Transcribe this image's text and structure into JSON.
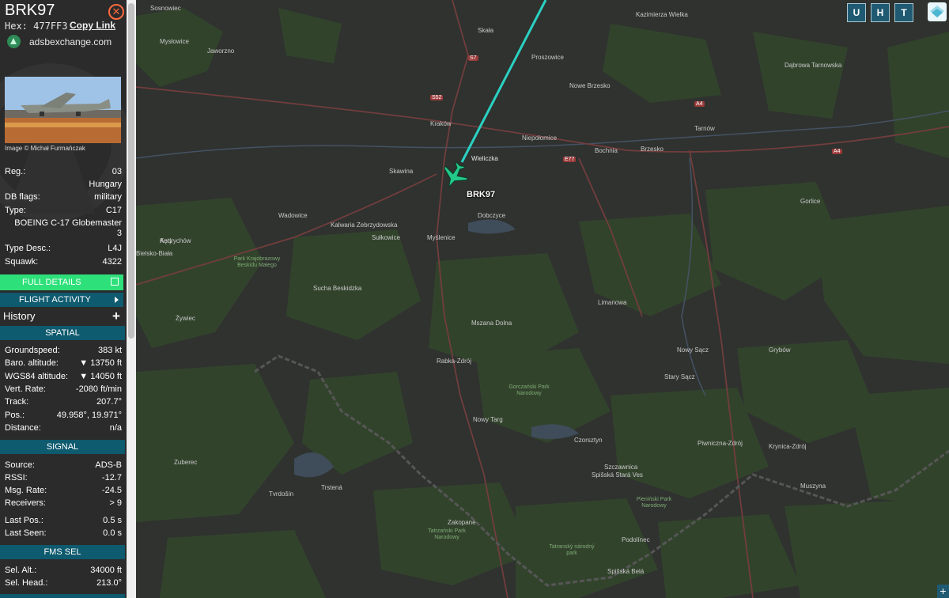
{
  "aircraft": {
    "callsign": "BRK97",
    "hex_label": "Hex:",
    "hex": "477FF3",
    "copy_link": "Copy Link",
    "source_site": "adsbexchange.com",
    "image_credit": "Image © Michał Furmańczak"
  },
  "details": [
    {
      "key": "Reg.:",
      "value": "03"
    },
    {
      "key": "",
      "value": "Hungary"
    },
    {
      "key": "DB flags:",
      "value": "military"
    },
    {
      "key": "Type:",
      "value": "C17"
    },
    {
      "key": "",
      "value": "BOEING C-17 Globemaster"
    },
    {
      "key": "",
      "value": "3"
    },
    {
      "key": "Type Desc.:",
      "value": "L4J"
    },
    {
      "key": "Squawk:",
      "value": "4322"
    }
  ],
  "buttons": {
    "full_details": "FULL DETAILS",
    "flight_activity": "FLIGHT ACTIVITY",
    "history": "History",
    "history_add": "+"
  },
  "spatial": {
    "title": "SPATIAL",
    "rows": [
      {
        "key": "Groundspeed:",
        "value": "383 kt"
      },
      {
        "key": "Baro. altitude:",
        "value": "▼ 13750 ft"
      },
      {
        "key": "WGS84 altitude:",
        "value": "▼ 14050 ft"
      },
      {
        "key": "Vert. Rate:",
        "value": "-2080 ft/min"
      },
      {
        "key": "Track:",
        "value": "207.7°"
      },
      {
        "key": "Pos.:",
        "value": "49.958°, 19.971°"
      },
      {
        "key": "Distance:",
        "value": "n/a"
      }
    ]
  },
  "signal": {
    "title": "SIGNAL",
    "rows": [
      {
        "key": "Source:",
        "value": "ADS-B"
      },
      {
        "key": "RSSI:",
        "value": "-12.7"
      },
      {
        "key": "Msg. Rate:",
        "value": "-24.5"
      },
      {
        "key": "Receivers:",
        "value": "> 9"
      },
      {
        "key": "Last Pos.:",
        "value": "0.5 s"
      },
      {
        "key": "Last Seen:",
        "value": "0.0 s"
      }
    ]
  },
  "fms": {
    "title": "FMS SEL",
    "rows": [
      {
        "key": "Sel. Alt.:",
        "value": "34000 ft"
      },
      {
        "key": "Sel. Head.:",
        "value": "213.0°"
      }
    ]
  },
  "map_controls": {
    "u": "U",
    "h": "H",
    "t": "T",
    "zoom_in": "+"
  },
  "map": {
    "plane_label": "BRK97",
    "places": [
      "Sosnowiec",
      "Mysłowice",
      "Jaworzno",
      "Kraków",
      "Wieliczka",
      "Niepołomice",
      "Bochnia",
      "Brzesko",
      "Tarnów",
      "Skała",
      "Proszowice",
      "Nowe Brzesko",
      "Kazimierza Wielka",
      "Dąbrowa Tarnowska",
      "Wadowice",
      "Sułkowice",
      "Myślenice",
      "Dobczyce",
      "Limanowa",
      "Nowy Sącz",
      "Stary Sącz",
      "Mszana Dolna",
      "Rabka-Zdrój",
      "Nowy Targ",
      "Zakopane",
      "Sucha Beskidzka",
      "Skawina",
      "Kalwaria Zebrzydowska",
      "Gorlice",
      "Grybów",
      "Krynica-Zdrój",
      "Piwniczna-Zdrój",
      "Szczawnica",
      "Czorsztyn",
      "Muszyna",
      "Podolínec",
      "Spišská Stará Ves",
      "Spišská Belá",
      "Trstená",
      "Tvrdošín",
      "Zuberec",
      "Wieliczka",
      "Kęty",
      "Żywiec",
      "Andrychów",
      "Bielsko-Biała"
    ],
    "park_labels": [
      "Park Krajobrazowy Beskidu Małego",
      "Tatrzański Park Narodowy",
      "Tatranský národný park",
      "Gorczański Park Narodowy",
      "Pieniński Park Narodowy"
    ],
    "roads": [
      "A4",
      "S7",
      "S52",
      "E77",
      "A4"
    ]
  },
  "colors": {
    "sidebar_bg": "#2b2b2b",
    "accent_green": "#2ee07a",
    "section_teal": "#0e5a6e",
    "track_cyan": "#2ad1c2",
    "close_orange": "#ff6a3d"
  }
}
